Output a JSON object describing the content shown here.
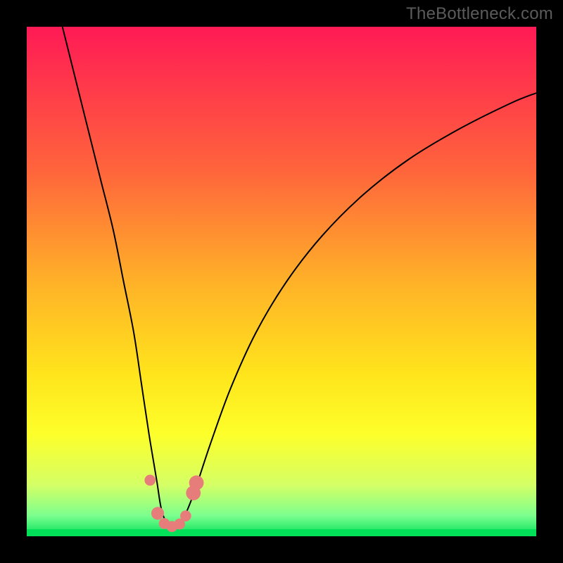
{
  "watermark": "TheBottleneck.com",
  "chart_data": {
    "type": "line",
    "title": "",
    "xlabel": "",
    "ylabel": "",
    "xlim": [
      0,
      100
    ],
    "ylim": [
      0,
      100
    ],
    "grid": false,
    "legend": false,
    "background": {
      "type": "vertical_gradient",
      "stops": [
        {
          "pos": 0.0,
          "color": "#ff1a55"
        },
        {
          "pos": 0.28,
          "color": "#ff643c"
        },
        {
          "pos": 0.5,
          "color": "#ffb128"
        },
        {
          "pos": 0.68,
          "color": "#ffe41c"
        },
        {
          "pos": 0.8,
          "color": "#fdff2a"
        },
        {
          "pos": 0.9,
          "color": "#d4ff66"
        },
        {
          "pos": 0.96,
          "color": "#7bff8e"
        },
        {
          "pos": 1.0,
          "color": "#02e05a"
        }
      ]
    },
    "curve_description": "Black V-shaped bottleneck curve: steep descent from upper-left, minimum near x≈28, asymmetric rise toward upper-right.",
    "curve_points": [
      {
        "x": 7.0,
        "y": 100.0
      },
      {
        "x": 9.5,
        "y": 90.0
      },
      {
        "x": 12.0,
        "y": 80.0
      },
      {
        "x": 14.5,
        "y": 70.0
      },
      {
        "x": 17.0,
        "y": 60.0
      },
      {
        "x": 19.0,
        "y": 50.0
      },
      {
        "x": 21.0,
        "y": 40.0
      },
      {
        "x": 22.5,
        "y": 30.0
      },
      {
        "x": 24.0,
        "y": 20.0
      },
      {
        "x": 25.5,
        "y": 11.0
      },
      {
        "x": 26.5,
        "y": 5.0
      },
      {
        "x": 28.0,
        "y": 1.8
      },
      {
        "x": 29.5,
        "y": 1.8
      },
      {
        "x": 31.0,
        "y": 4.0
      },
      {
        "x": 33.0,
        "y": 9.0
      },
      {
        "x": 36.0,
        "y": 18.0
      },
      {
        "x": 40.0,
        "y": 29.0
      },
      {
        "x": 45.0,
        "y": 40.0
      },
      {
        "x": 51.0,
        "y": 50.0
      },
      {
        "x": 58.0,
        "y": 59.0
      },
      {
        "x": 66.0,
        "y": 67.0
      },
      {
        "x": 75.0,
        "y": 74.0
      },
      {
        "x": 85.0,
        "y": 80.0
      },
      {
        "x": 95.0,
        "y": 85.0
      },
      {
        "x": 100.0,
        "y": 87.0
      }
    ],
    "markers": [
      {
        "x": 24.2,
        "y": 11.0,
        "r": 1.2
      },
      {
        "x": 25.7,
        "y": 4.5,
        "r": 1.4
      },
      {
        "x": 27.0,
        "y": 2.5,
        "r": 1.2
      },
      {
        "x": 28.5,
        "y": 1.9,
        "r": 1.2
      },
      {
        "x": 30.0,
        "y": 2.4,
        "r": 1.2
      },
      {
        "x": 31.2,
        "y": 4.0,
        "r": 1.2
      },
      {
        "x": 32.7,
        "y": 8.5,
        "r": 1.6
      },
      {
        "x": 33.3,
        "y": 10.5,
        "r": 1.6
      }
    ],
    "marker_color": "#e77d7a",
    "curve_color": "#000000",
    "bottom_band_color": "#02e05a"
  }
}
